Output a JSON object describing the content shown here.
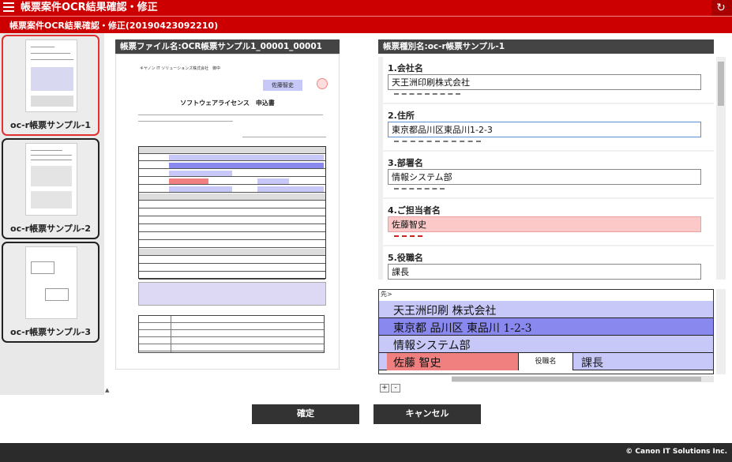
{
  "header": {
    "title": "帳票案件OCR結果確認・修正",
    "subtitle": "帳票案件OCR結果確認・修正(20190423092210)"
  },
  "thumbnails": [
    {
      "label": "oc-r帳票サンプル-1",
      "active": true
    },
    {
      "label": "oc-r帳票サンプル-2",
      "active": false
    },
    {
      "label": "oc-r帳票サンプル-3",
      "active": false
    }
  ],
  "document": {
    "header": "帳票ファイル名:OCR帳票サンプル1_00001_00001",
    "company": "キヤノン IT ソリューションズ株式会社　御中",
    "signature": "佐藤智史",
    "title": "ソフトウェアライセンス　申込書"
  },
  "fields": {
    "header": "帳票種別名:oc-r帳票サンプル-1",
    "items": [
      {
        "label": "1.会社名",
        "value": "天王洲印刷株式会社",
        "state": "normal"
      },
      {
        "label": "2.住所",
        "value": "東京都品川区東品川1-2-3",
        "state": "focus"
      },
      {
        "label": "3.部署名",
        "value": "情報システム部",
        "state": "normal"
      },
      {
        "label": "4.ご担当者名",
        "value": "佐藤智史",
        "state": "warn"
      },
      {
        "label": "5.役職名",
        "value": "課長",
        "state": "normal"
      }
    ]
  },
  "crop": {
    "prefix": "先>",
    "rows": [
      "天王洲印刷 株式会社",
      "東京都 品川区 東品川 1-2-3",
      "情報システム部",
      "佐藤 智史"
    ],
    "title_label": "役職名",
    "title_value": "課長"
  },
  "zoom": {
    "plus": "+",
    "minus": "-"
  },
  "buttons": {
    "confirm": "確定",
    "cancel": "キャンセル"
  },
  "footer": {
    "copyright": "© Canon IT Solutions Inc."
  },
  "colors": {
    "brand": "#cc0000",
    "warn": "#fcc8c8",
    "highlight": "#c8c8f8"
  }
}
